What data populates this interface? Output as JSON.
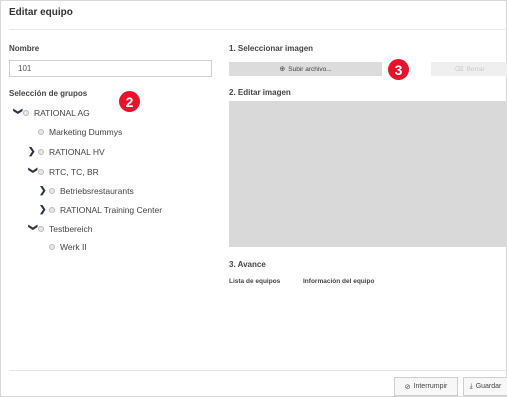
{
  "dialog": {
    "title": "Editar equipo"
  },
  "name_section": {
    "label": "Nombre",
    "value": "101"
  },
  "groups_section": {
    "label": "Selección de grupos",
    "items": [
      {
        "label": "RATIONAL AG",
        "expander": "expanded"
      },
      {
        "label": "Marketing Dummys",
        "expander": "none"
      },
      {
        "label": "RATIONAL HV",
        "expander": "collapsed"
      },
      {
        "label": "RTC, TC, BR",
        "expander": "expanded"
      },
      {
        "label": "Betriebsrestaurants",
        "expander": "collapsed"
      },
      {
        "label": "RATIONAL Training Center",
        "expander": "collapsed"
      },
      {
        "label": "Testbereich",
        "expander": "expanded"
      },
      {
        "label": "Werk II",
        "expander": "none"
      }
    ]
  },
  "image_section": {
    "step1_label": "1. Seleccionar imagen",
    "upload_label": "Subir archivo...",
    "delete_label": "Borrar",
    "step2_label": "2. Editar imagen"
  },
  "progress_section": {
    "step3_label": "3. Avance",
    "col1": "Lista de equipos",
    "col2": "Información del equipo"
  },
  "footer": {
    "cancel_label": "Interrumpir",
    "save_label": "Guardar"
  },
  "badges": {
    "badge2": "2",
    "badge3": "3"
  },
  "colors": {
    "badge": "#e8132b",
    "chevron": "#2a3340",
    "image_area": "#d9d9d9"
  }
}
